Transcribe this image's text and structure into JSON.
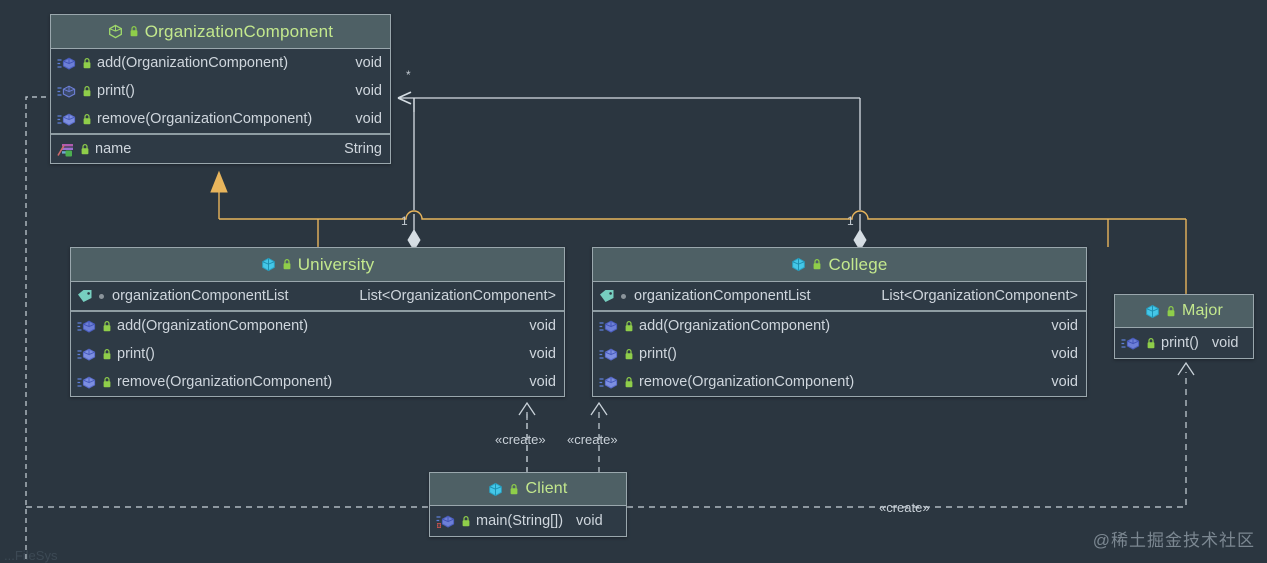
{
  "canvas": {
    "background": "#2b3640",
    "watermark": "@稀土掘金技术社区",
    "bottom_cut_text": "...FileSys"
  },
  "colors": {
    "box_header_bg": "#4e6065",
    "box_body_bg": "#2e3a45",
    "box_border": "#9aa7ad",
    "class_title": "#c3e88d",
    "member_text": "#cfd6dd",
    "inheritance_line": "#e8b55c",
    "association_line": "#d5dde3",
    "dashed_line": "#c9d2d9"
  },
  "classes": {
    "organization_component": {
      "title": "OrganizationComponent",
      "title_icons": [
        "interface-cube-icon",
        "lock-icon"
      ],
      "methods": [
        {
          "icon": "method-icon",
          "lock": "lock-icon",
          "name": "add(OrganizationComponent)",
          "type": "void"
        },
        {
          "icon": "method-icon",
          "lock": "lock-icon",
          "name": "print()",
          "type": "void"
        },
        {
          "icon": "method-icon",
          "lock": "lock-icon",
          "name": "remove(OrganizationComponent)",
          "type": "void"
        }
      ],
      "fields": [
        {
          "icon": "property-icon",
          "lock": "lock-icon",
          "name": "name",
          "type": "String"
        }
      ]
    },
    "university": {
      "title": "University",
      "title_icons": [
        "class-cube-icon",
        "lock-icon"
      ],
      "fields": [
        {
          "icon": "tag-icon",
          "dot": "gray-dot-icon",
          "name": "organizationComponentList",
          "type": "List<OrganizationComponent>"
        }
      ],
      "methods": [
        {
          "icon": "method-icon",
          "lock": "lock-icon",
          "name": "add(OrganizationComponent)",
          "type": "void"
        },
        {
          "icon": "method-icon",
          "lock": "lock-icon",
          "name": "print()",
          "type": "void"
        },
        {
          "icon": "method-icon",
          "lock": "lock-icon",
          "name": "remove(OrganizationComponent)",
          "type": "void"
        }
      ]
    },
    "college": {
      "title": "College",
      "title_icons": [
        "class-cube-icon",
        "lock-icon"
      ],
      "fields": [
        {
          "icon": "tag-icon",
          "dot": "gray-dot-icon",
          "name": "organizationComponentList",
          "type": "List<OrganizationComponent>"
        }
      ],
      "methods": [
        {
          "icon": "method-icon",
          "lock": "lock-icon",
          "name": "add(OrganizationComponent)",
          "type": "void"
        },
        {
          "icon": "method-icon",
          "lock": "lock-icon",
          "name": "print()",
          "type": "void"
        },
        {
          "icon": "method-icon",
          "lock": "lock-icon",
          "name": "remove(OrganizationComponent)",
          "type": "void"
        }
      ]
    },
    "major": {
      "title": "Major",
      "title_icons": [
        "class-cube-icon",
        "lock-icon"
      ],
      "methods": [
        {
          "icon": "method-icon",
          "lock": "lock-icon",
          "name": "print()",
          "type": "void"
        }
      ]
    },
    "client": {
      "title": "Client",
      "title_icons": [
        "class-cube-icon",
        "lock-icon"
      ],
      "methods": [
        {
          "icon": "main-method-icon",
          "lock": "lock-icon",
          "name": "main(String[])",
          "type": "void"
        }
      ]
    }
  },
  "edge_labels": {
    "star_multiplicity": "*",
    "university_multiplicity": "1",
    "college_multiplicity": "1",
    "create_university": "«create»",
    "create_college": "«create»",
    "create_major": "«create»"
  }
}
